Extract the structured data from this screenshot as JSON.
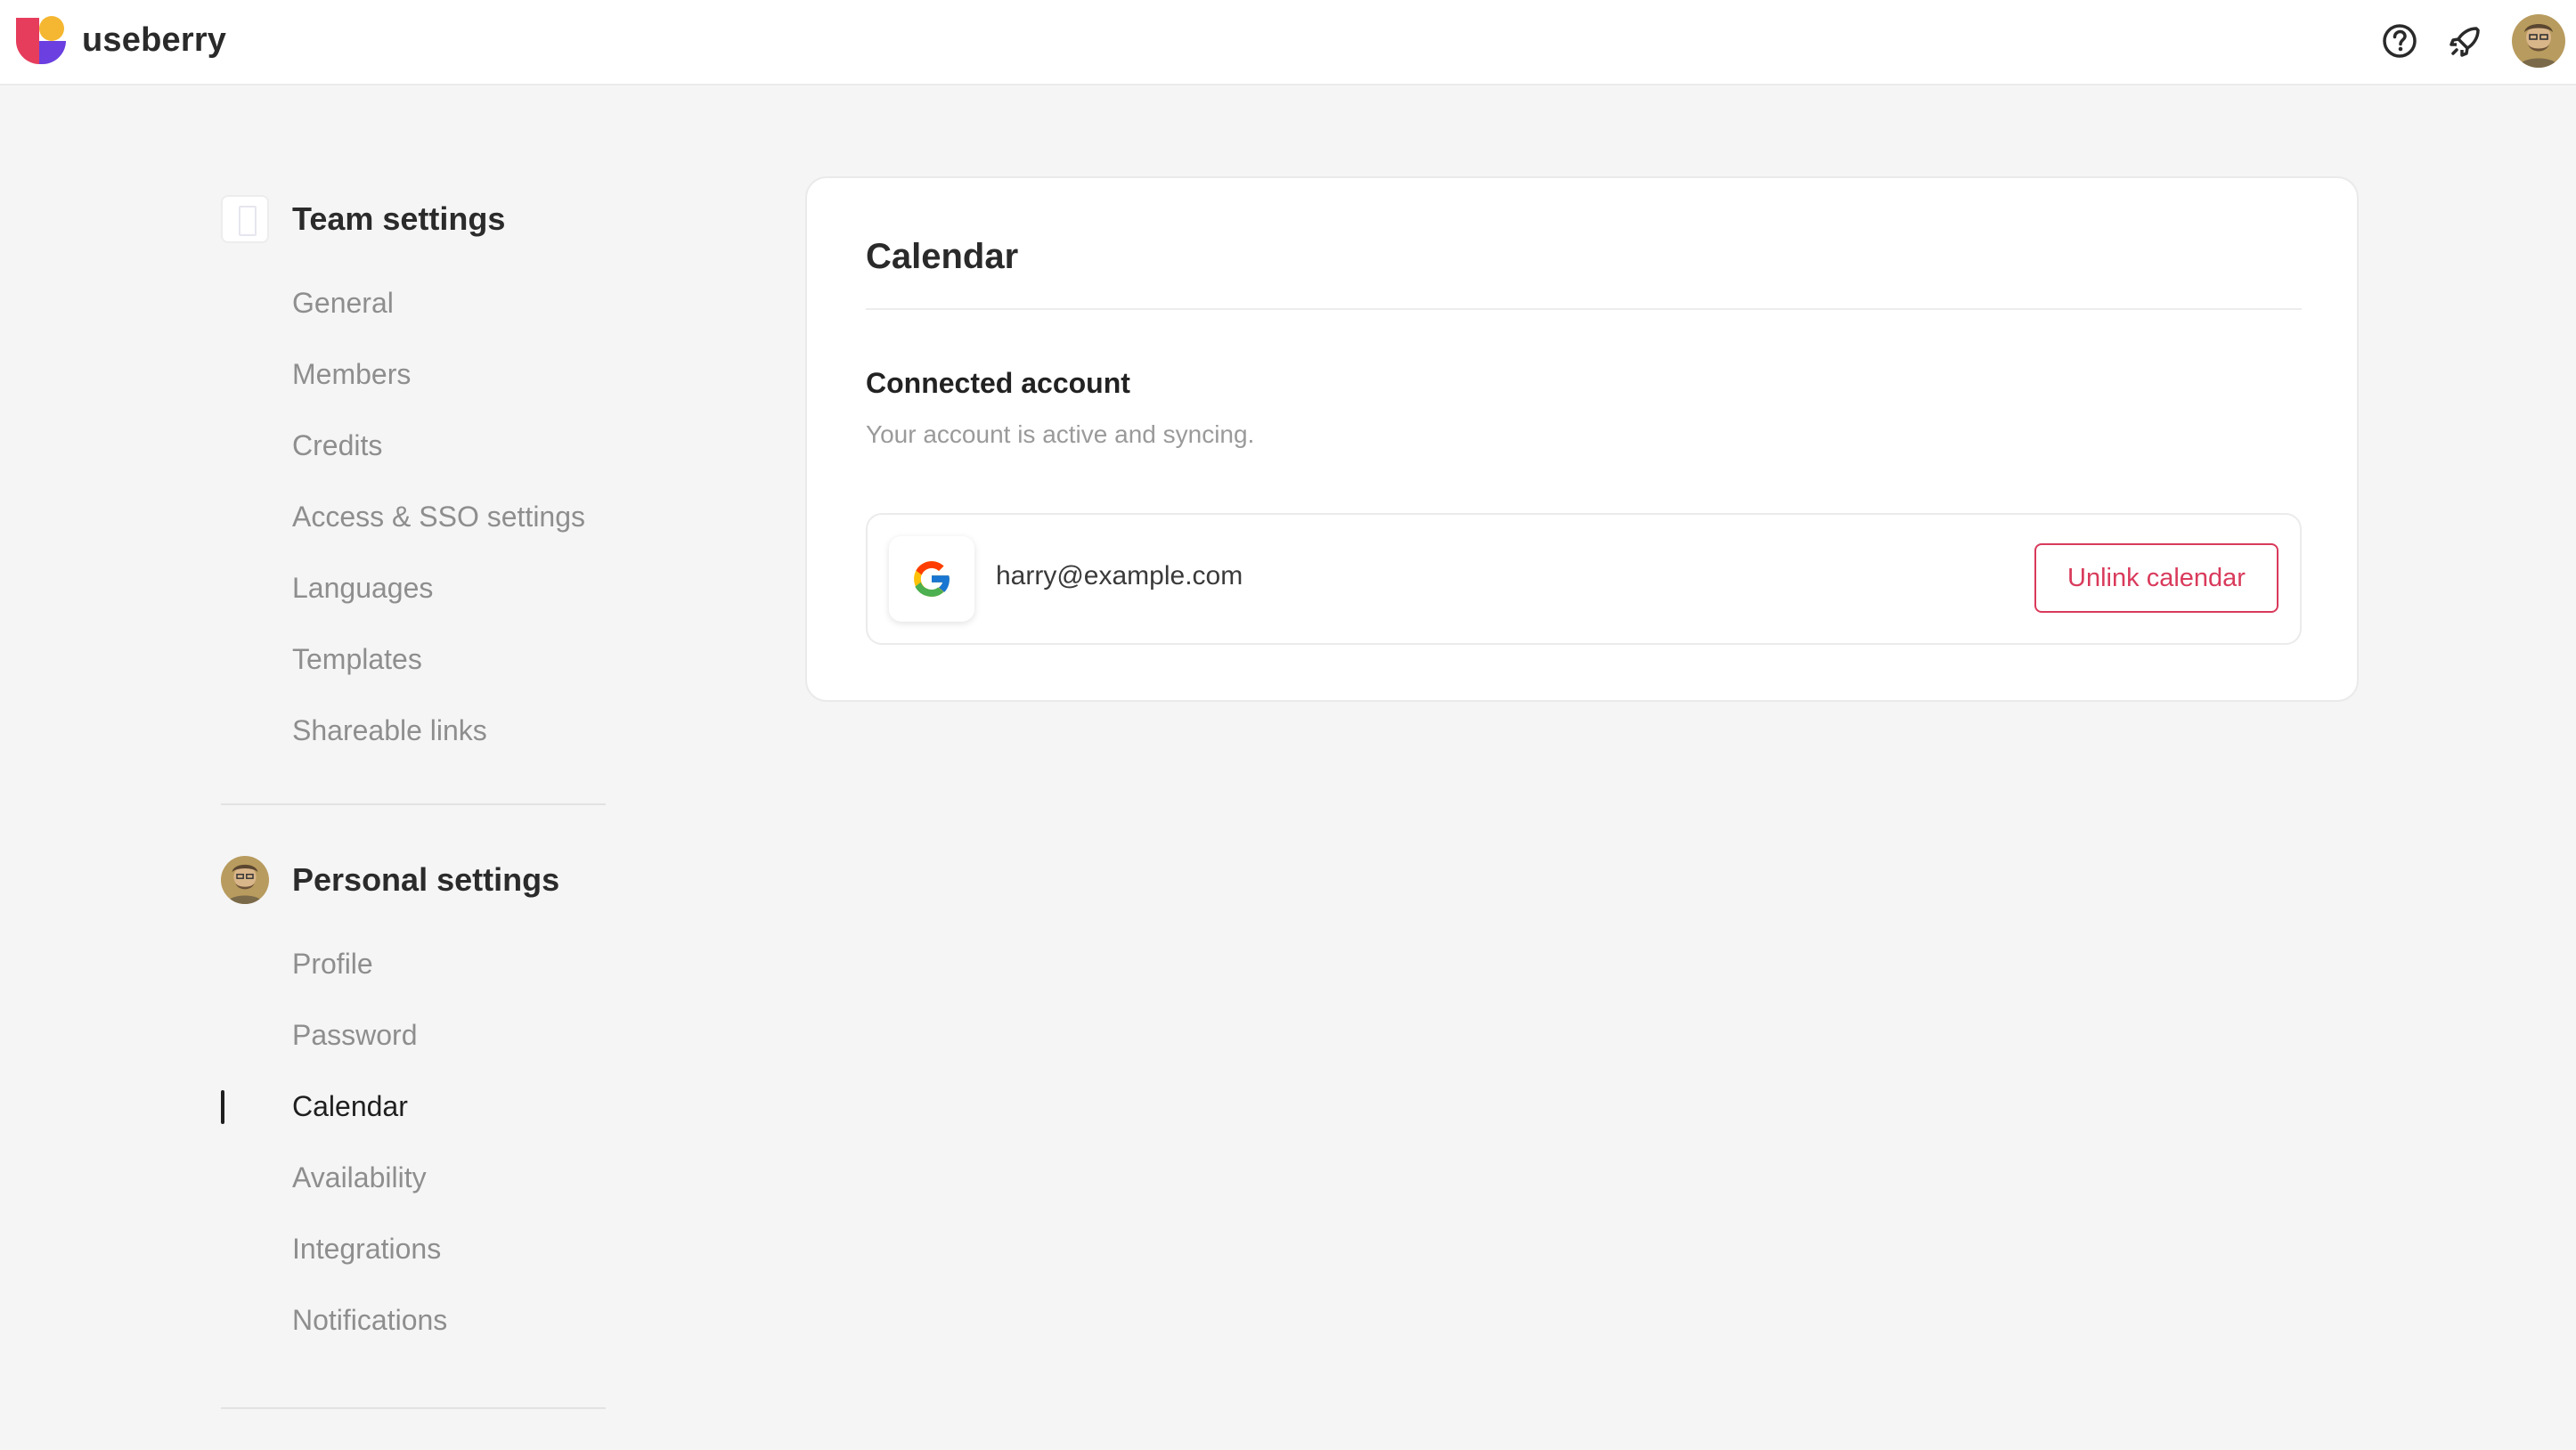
{
  "brand": {
    "name": "useberry",
    "logo_icon": "useberry-logo-icon"
  },
  "header": {
    "icons": [
      {
        "name": "help-icon"
      },
      {
        "name": "rocket-icon"
      },
      {
        "name": "user-avatar"
      }
    ]
  },
  "sidebar": {
    "team": {
      "title": "Team settings",
      "items": [
        "General",
        "Members",
        "Credits",
        "Access & SSO settings",
        "Languages",
        "Templates",
        "Shareable links"
      ]
    },
    "personal": {
      "title": "Personal settings",
      "items": [
        "Profile",
        "Password",
        "Calendar",
        "Availability",
        "Integrations",
        "Notifications"
      ],
      "active": "Calendar"
    }
  },
  "main": {
    "title": "Calendar",
    "section_title": "Connected account",
    "section_subtitle": "Your account is active and syncing.",
    "account": {
      "provider_icon": "google-icon",
      "email": "harry@example.com",
      "unlink_label": "Unlink calendar"
    }
  },
  "colors": {
    "accent": "#d93a5b",
    "active_indicator": "#1f1f1f"
  }
}
